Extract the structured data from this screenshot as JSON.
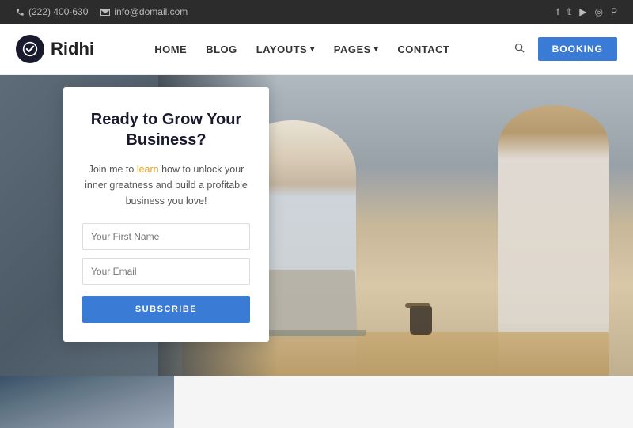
{
  "topbar": {
    "phone": "(222) 400-630",
    "email": "info@domail.com"
  },
  "logo": {
    "text": "Ridhi"
  },
  "nav": {
    "items": [
      {
        "label": "HOME",
        "has_dropdown": false
      },
      {
        "label": "BLOG",
        "has_dropdown": false
      },
      {
        "label": "LAYOUTS",
        "has_dropdown": true
      },
      {
        "label": "PAGES",
        "has_dropdown": true
      },
      {
        "label": "CONTACT",
        "has_dropdown": false
      }
    ]
  },
  "header": {
    "booking_label": "BOOKING"
  },
  "social": {
    "items": [
      "f",
      "t",
      "▶",
      "◎",
      "𝐏"
    ]
  },
  "form": {
    "title": "Ready to Grow Your Business?",
    "description_start": "Join me to ",
    "description_highlight": "learn",
    "description_end": " how to unlock your inner greatness and build a profitable business you love!",
    "first_name_placeholder": "Your First Name",
    "email_placeholder": "Your Email",
    "subscribe_label": "SUBSCRIBE"
  }
}
